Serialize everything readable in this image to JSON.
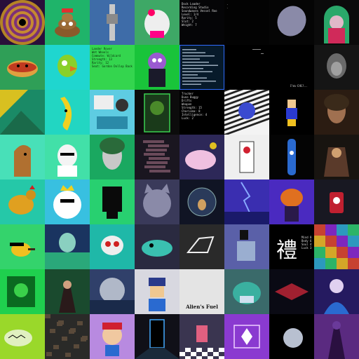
{
  "gallery": {
    "rows": 8,
    "columns": 8,
    "tiles": [
      {
        "name": "kaleidoscope",
        "bg": "#2a0f3a"
      },
      {
        "name": "poop-emoji-character",
        "bg": "#1fb46a"
      },
      {
        "name": "robot-statue",
        "bg": "#3e6ca8"
      },
      {
        "name": "white-bear-plush",
        "bg": "#3ea866"
      },
      {
        "name": "text-stats-panel",
        "bg": "#050507",
        "lines": [
          "Dock Loader",
          "Recording Studio",
          "Soundwaves Vessel Roo",
          "Level: 1/4",
          "Rarity: 5",
          "Slot: 2",
          "Weight: 7"
        ]
      },
      {
        "name": "dark-terminal",
        "bg": "#030303",
        "lines": [
          ".",
          "."
        ]
      },
      {
        "name": "crystal-gem",
        "bg": "#050505"
      },
      {
        "name": "arch-portrait",
        "bg": "#0b0b0b"
      },
      {
        "name": "hotdog-character",
        "bg": "#2f9f57"
      },
      {
        "name": "green-parrot",
        "bg": "#1fd6cf"
      },
      {
        "name": "green-stats-panel",
        "bg": "#34d54e",
        "lines": [
          "Lander Rover",
          "Wet Wheels",
          "Commute: Wildcard",
          "Strength: 13",
          "Rarity: 12",
          "Seat: Gordon Dollop Back"
        ]
      },
      {
        "name": "purple-blob-suit",
        "bg": "#19c43a"
      },
      {
        "name": "code-listing",
        "bg": "#071a2a"
      },
      {
        "name": "sparse-terminal",
        "bg": "#000000"
      },
      {
        "name": "im-ok-text",
        "bg": "#000000",
        "text": "I'm OK!..."
      },
      {
        "name": "shadow-face",
        "bg": "#151515"
      },
      {
        "name": "yellow-geometric",
        "bg": "#1a8a66"
      },
      {
        "name": "banana-character",
        "bg": "#22d6c2"
      },
      {
        "name": "cyan-collage",
        "bg": "#5ecce2"
      },
      {
        "name": "leaf-frame",
        "bg": "#0c0c0c"
      },
      {
        "name": "black-stats-panel",
        "bg": "#000000",
        "lines": [
          "Trucker",
          "Dune Buggy",
          "Drifts",
          "Weapon",
          "Strength: 15",
          "Charisma: 8",
          "Intelligence: 4",
          "Luck: 2"
        ]
      },
      {
        "name": "blue-cat-stripes",
        "bg": "#f3f3f3"
      },
      {
        "name": "pixel-character",
        "bg": "#000000"
      },
      {
        "name": "woman-portrait",
        "bg": "#2b1c12"
      },
      {
        "name": "horse-character",
        "bg": "#48e0b8"
      },
      {
        "name": "white-dog",
        "bg": "#42e0a8"
      },
      {
        "name": "green-mask-face",
        "bg": "#1aa860"
      },
      {
        "name": "glitch-figure",
        "bg": "#1a1620"
      },
      {
        "name": "pink-whale",
        "bg": "#2d2858"
      },
      {
        "name": "hand-card",
        "bg": "#efefef"
      },
      {
        "name": "bottle-alien",
        "bg": "#040404"
      },
      {
        "name": "armored-samurai",
        "bg": "#181410"
      },
      {
        "name": "golden-rooster",
        "bg": "#25c8a8"
      },
      {
        "name": "king-bear",
        "bg": "#38c0e0"
      },
      {
        "name": "pixel-ghost",
        "bg": "#28d070"
      },
      {
        "name": "silver-cat",
        "bg": "#3a3a5a"
      },
      {
        "name": "glass-orb",
        "bg": "#101424"
      },
      {
        "name": "lightning-scene",
        "bg": "#3a2eb0"
      },
      {
        "name": "pumpkin-head",
        "bg": "#4a2ac0"
      },
      {
        "name": "robot-box",
        "bg": "#181822"
      },
      {
        "name": "bee-driver",
        "bg": "#34d36c"
      },
      {
        "name": "cyber-portrait",
        "bg": "#1a3460"
      },
      {
        "name": "white-robot",
        "bg": "#1fb8a8"
      },
      {
        "name": "teal-creature",
        "bg": "#2a2a40"
      },
      {
        "name": "skeleton-horse",
        "bg": "#2a2a2a"
      },
      {
        "name": "pixel-silhouette",
        "bg": "#5a60a8"
      },
      {
        "name": "kanji-card",
        "bg": "#000000",
        "glyph": "禮",
        "lines": [
          "Mind 8",
          "Body 6",
          "Soul 4",
          "Luck 3"
        ]
      },
      {
        "name": "colorful-mosaic",
        "bg": "#3a1a5a"
      },
      {
        "name": "green-glitch",
        "bg": "#1fd04e"
      },
      {
        "name": "dark-wizard",
        "bg": "#1a4a2e"
      },
      {
        "name": "planet-sea",
        "bg": "#30406a"
      },
      {
        "name": "pixel-beanie",
        "bg": "#d8d8e0"
      },
      {
        "name": "poster-woman",
        "bg": "#e4e4e4",
        "caption": "Alien's Fuel"
      },
      {
        "name": "masked-hippo",
        "bg": "#3a6a6a"
      },
      {
        "name": "red-ship",
        "bg": "#0a0a14"
      },
      {
        "name": "blue-girl",
        "bg": "#251a60"
      },
      {
        "name": "lime-whale",
        "bg": "#9ad82a"
      },
      {
        "name": "rubble-pile",
        "bg": "#2a2a28"
      },
      {
        "name": "cap-cartoon",
        "bg": "#b88ae0"
      },
      {
        "name": "neon-door",
        "bg": "#101018"
      },
      {
        "name": "checkered-room",
        "bg": "#3a3550"
      },
      {
        "name": "purple-circuit",
        "bg": "#8a3ad0"
      },
      {
        "name": "moon-space",
        "bg": "#000000"
      },
      {
        "name": "purple-figure",
        "bg": "#5a2a80"
      }
    ]
  }
}
